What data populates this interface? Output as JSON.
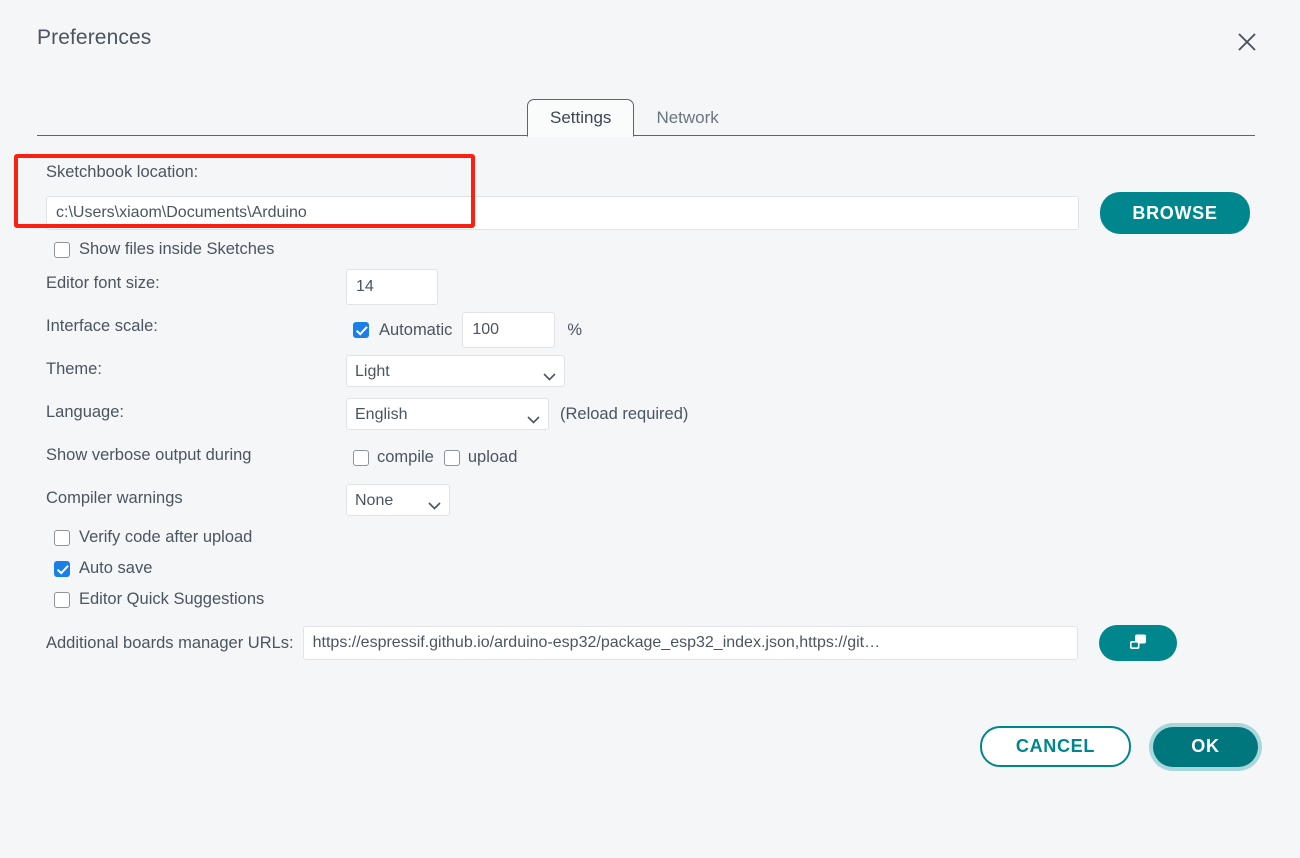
{
  "window": {
    "title": "Preferences",
    "close_icon": "close-icon"
  },
  "tabs": [
    {
      "label": "Settings",
      "active": true
    },
    {
      "label": "Network",
      "active": false
    }
  ],
  "settings": {
    "sketchbook": {
      "label": "Sketchbook location:",
      "value": "c:\\Users\\xiaom\\Documents\\Arduino",
      "browse_label": "BROWSE"
    },
    "show_files_inside_sketches": {
      "label": "Show files inside Sketches",
      "checked": false
    },
    "editor_font_size": {
      "label": "Editor font size:",
      "value": "14"
    },
    "interface_scale": {
      "label": "Interface scale:",
      "automatic_label": "Automatic",
      "automatic_checked": true,
      "value": "100",
      "unit": "%"
    },
    "theme": {
      "label": "Theme:",
      "value": "Light",
      "options": [
        "Light"
      ]
    },
    "language": {
      "label": "Language:",
      "value": "English",
      "options": [
        "English"
      ],
      "note": "(Reload required)"
    },
    "verbose_output": {
      "label": "Show verbose output during",
      "compile_label": "compile",
      "compile_checked": false,
      "upload_label": "upload",
      "upload_checked": false
    },
    "compiler_warnings": {
      "label": "Compiler warnings",
      "value": "None",
      "options": [
        "None"
      ]
    },
    "verify_code_after_upload": {
      "label": "Verify code after upload",
      "checked": false
    },
    "auto_save": {
      "label": "Auto save",
      "checked": true
    },
    "editor_quick_suggestions": {
      "label": "Editor Quick Suggestions",
      "checked": false
    },
    "additional_urls": {
      "label": "Additional boards manager URLs:",
      "value": "https://espressif.github.io/arduino-esp32/package_esp32_index.json,https://git…",
      "expand_icon": "open-in-window-icon"
    }
  },
  "footer": {
    "cancel_label": "CANCEL",
    "ok_label": "OK"
  },
  "annotation": {
    "color": "#fb2112",
    "target": "sketchbook-location-field"
  }
}
